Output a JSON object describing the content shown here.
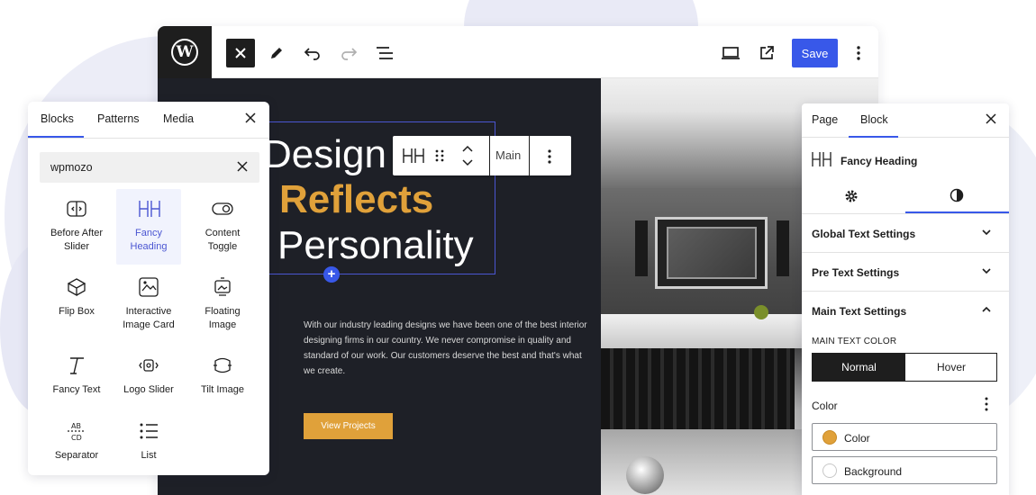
{
  "toolbar": {
    "wp_logo": "W",
    "save_label": "Save",
    "icons": [
      "close-icon",
      "pencil-icon",
      "undo-icon",
      "redo-icon",
      "list-view-icon",
      "desktop-preview-icon",
      "external-view-icon",
      "more-options-icon"
    ]
  },
  "canvas": {
    "heading_pre": "Design",
    "heading_main": "Reflects",
    "heading_post": "Personality",
    "paragraph": "With our industry leading designs we have been one of the best interior designing firms in our country. We never compromise in quality and standard of our work. Our customers deserve the best and that's what we create.",
    "button_label": "View Projects",
    "block_toolbar": {
      "label": "Main"
    },
    "colors": {
      "dark_bg": "#1e2027",
      "accent": "#e0a13a",
      "selection": "#4b56d2"
    }
  },
  "inserter": {
    "tabs": [
      "Blocks",
      "Patterns",
      "Media"
    ],
    "active_tab": "Blocks",
    "search_value": "wpmozo",
    "items": [
      {
        "label_1": "Before After",
        "label_2": "Slider",
        "icon": "before-after-slider-icon"
      },
      {
        "label_1": "Fancy",
        "label_2": "Heading",
        "icon": "fancy-heading-icon",
        "highlighted": true
      },
      {
        "label_1": "Content",
        "label_2": "Toggle",
        "icon": "content-toggle-icon"
      },
      {
        "label_1": "Flip Box",
        "label_2": "",
        "icon": "flip-box-icon"
      },
      {
        "label_1": "Interactive",
        "label_2": "Image Card",
        "icon": "interactive-image-card-icon"
      },
      {
        "label_1": "Floating",
        "label_2": "Image",
        "icon": "floating-image-icon"
      },
      {
        "label_1": "Fancy Text",
        "label_2": "",
        "icon": "fancy-text-icon"
      },
      {
        "label_1": "Logo Slider",
        "label_2": "",
        "icon": "logo-slider-icon"
      },
      {
        "label_1": "Tilt Image",
        "label_2": "",
        "icon": "tilt-image-icon"
      },
      {
        "label_1": "Separator",
        "label_2": "",
        "icon": "separator-icon"
      },
      {
        "label_1": "List",
        "label_2": "",
        "icon": "list-icon"
      }
    ]
  },
  "settings": {
    "tabs": [
      "Page",
      "Block"
    ],
    "active_tab": "Block",
    "block_name": "Fancy Heading",
    "sections": [
      "Global Text Settings",
      "Pre Text Settings",
      "Main Text Settings"
    ],
    "main_text_color_label": "MAIN TEXT COLOR",
    "toggle": {
      "normal": "Normal",
      "hover": "Hover",
      "active": "Normal"
    },
    "color_label": "Color",
    "color_options": [
      {
        "label": "Color",
        "swatch": "#e0a13a"
      },
      {
        "label": "Background",
        "swatch": "#ffffff"
      }
    ],
    "accent": "#3858e9"
  }
}
